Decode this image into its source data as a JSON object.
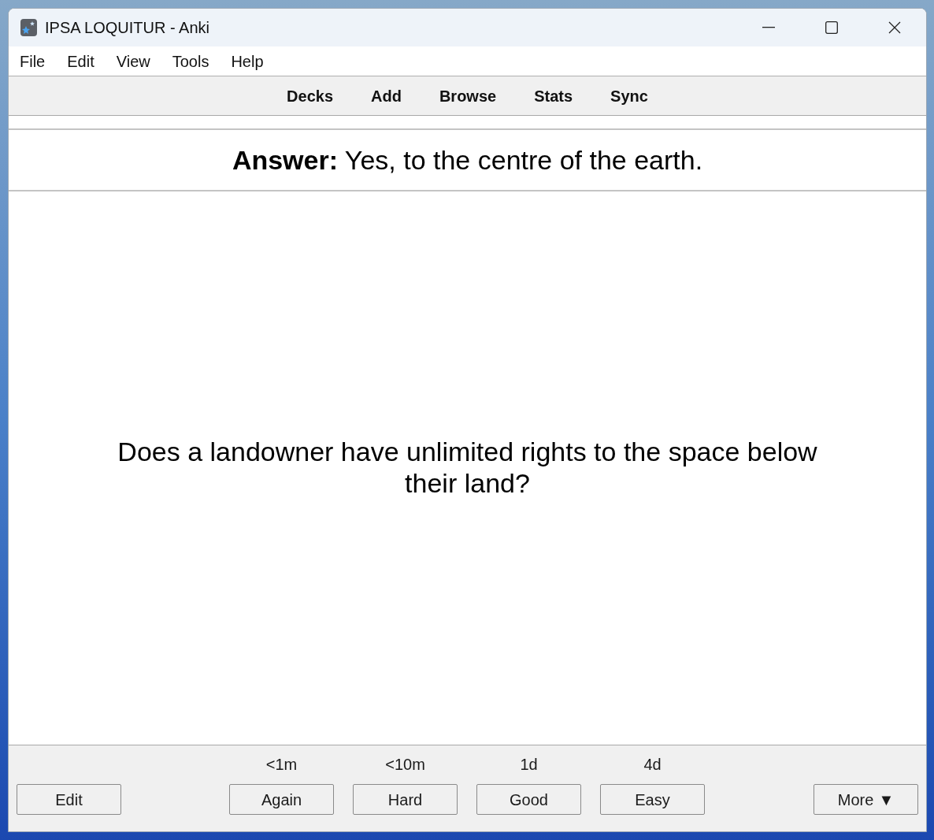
{
  "window": {
    "title": "IPSA LOQUITUR - Anki"
  },
  "menu": [
    "File",
    "Edit",
    "View",
    "Tools",
    "Help"
  ],
  "toolbar": [
    "Decks",
    "Add",
    "Browse",
    "Stats",
    "Sync"
  ],
  "answer": "**Answer:** Yes, to the centre of the earth.",
  "question": "Does a landowner have unlimited rights to the space below their land?",
  "bottom": {
    "edit_button": "Edit",
    "answer_buttons": [
      {
        "interval": "<1m",
        "label": "Again"
      },
      {
        "interval": "<10m",
        "label": "Hard"
      },
      {
        "interval": "1d",
        "label": "Good"
      },
      {
        "interval": "4d",
        "label": "Easy"
      }
    ],
    "more_button": {
      "label": "More",
      "arrow": "▼"
    }
  }
}
